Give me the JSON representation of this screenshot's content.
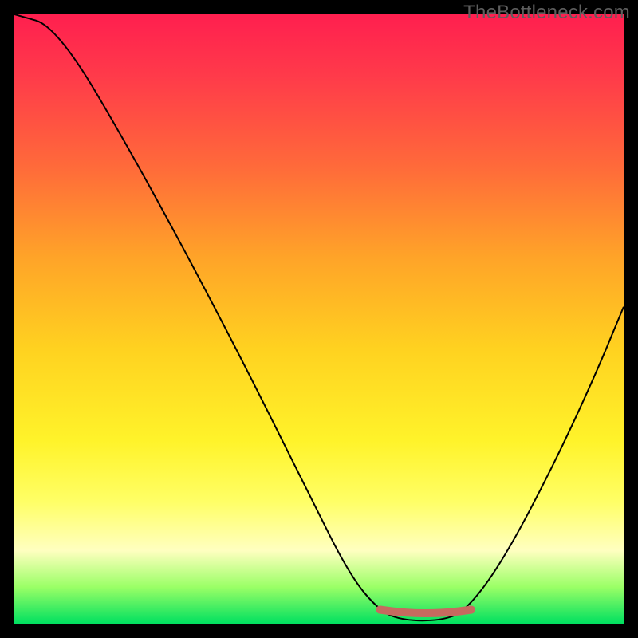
{
  "watermark": {
    "text": "TheBottleneck.com"
  },
  "chart_data": {
    "type": "line",
    "title": "",
    "xlabel": "",
    "ylabel": "",
    "xlim": [
      0,
      100
    ],
    "ylim": [
      0,
      100
    ],
    "grid": false,
    "curve": [
      {
        "x": 0,
        "y": 100
      },
      {
        "x": 7,
        "y": 98
      },
      {
        "x": 20,
        "y": 76
      },
      {
        "x": 35,
        "y": 48
      },
      {
        "x": 48,
        "y": 22
      },
      {
        "x": 55,
        "y": 8
      },
      {
        "x": 60,
        "y": 2
      },
      {
        "x": 64,
        "y": 0.5
      },
      {
        "x": 70,
        "y": 0.5
      },
      {
        "x": 74,
        "y": 2
      },
      {
        "x": 80,
        "y": 10
      },
      {
        "x": 88,
        "y": 25
      },
      {
        "x": 95,
        "y": 40
      },
      {
        "x": 100,
        "y": 52
      }
    ],
    "optimal_range": {
      "x_start": 60,
      "x_end": 75,
      "y": 1.5
    },
    "marker_color": "#c66a5f",
    "background_gradient_stops": [
      {
        "offset": 0,
        "color": "#ff1f4f"
      },
      {
        "offset": 25,
        "color": "#ff6a3a"
      },
      {
        "offset": 55,
        "color": "#ffd220"
      },
      {
        "offset": 80,
        "color": "#ffff66"
      },
      {
        "offset": 100,
        "color": "#00e060"
      }
    ]
  }
}
